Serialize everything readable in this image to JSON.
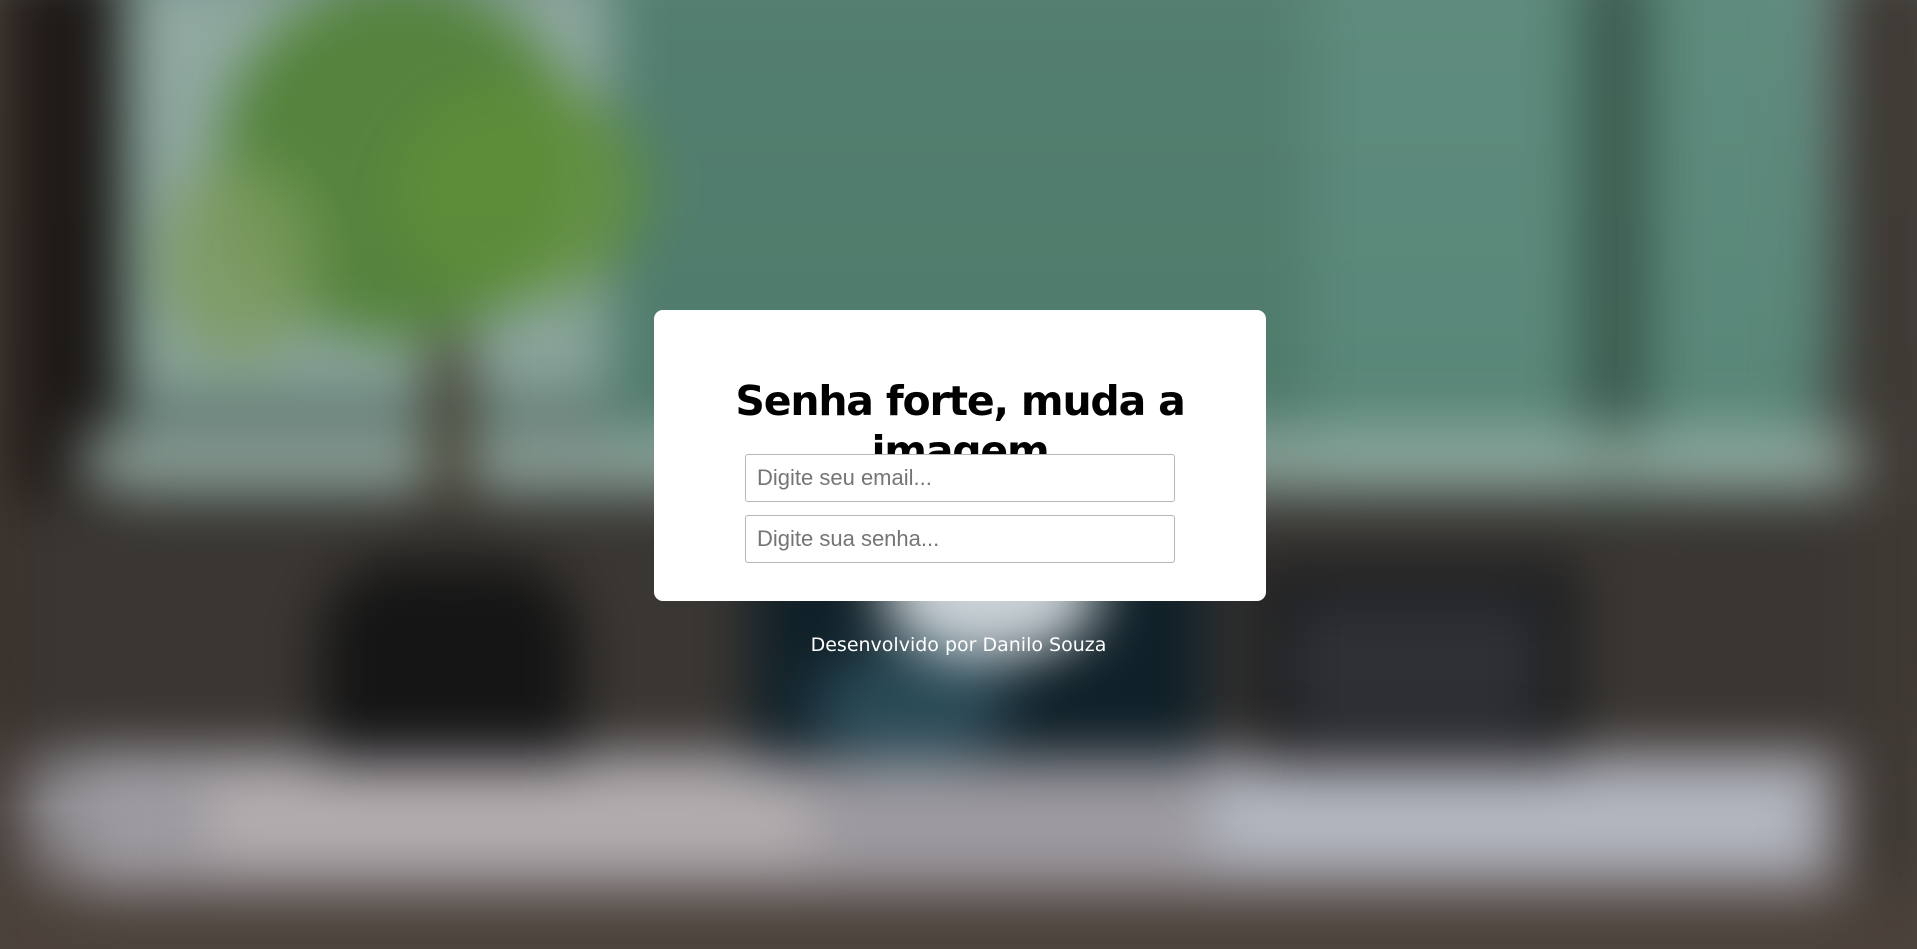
{
  "page": {
    "background_description_colors": {
      "window_green": "#4f7c6c",
      "plant_green": "#4f7f33",
      "dark_pot": "#1c1c1c",
      "desk_gray": "#9d9aa0"
    }
  },
  "card": {
    "title": "Senha forte, muda a imagem",
    "email_placeholder": "Digite seu email...",
    "password_placeholder": "Digite sua senha...",
    "background": "#ffffff"
  },
  "footer": {
    "text": "Desenvolvido por Danilo Souza"
  }
}
